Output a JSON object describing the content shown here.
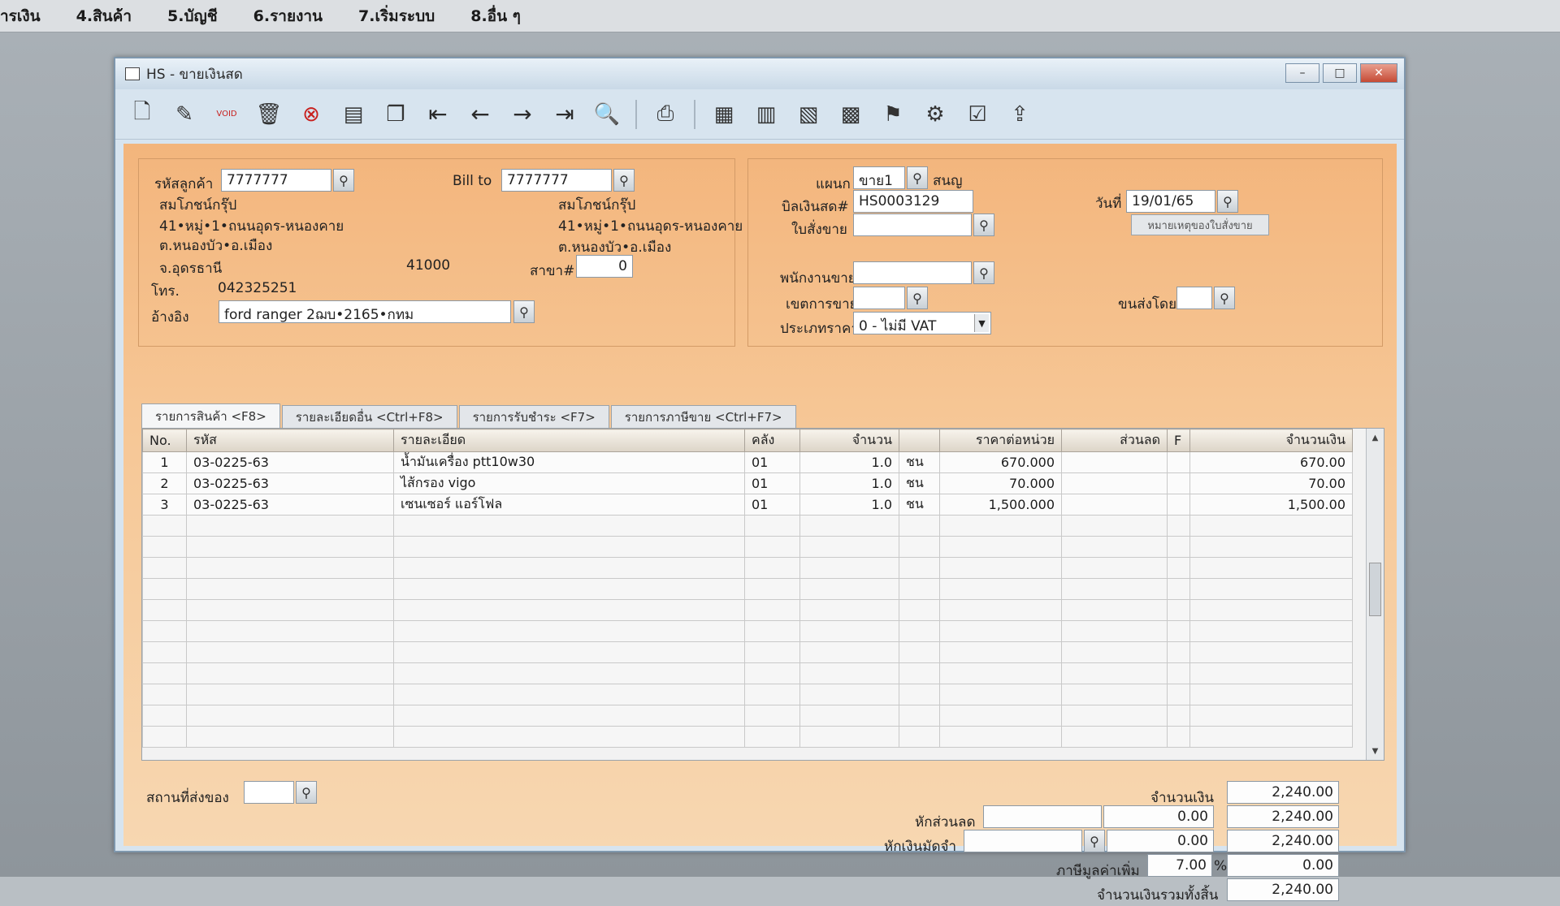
{
  "menubar": [
    "ารเงิน",
    "4.สินค้า",
    "5.บัญชี",
    "6.รายงาน",
    "7.เริ่มระบบ",
    "8.อื่น ๆ"
  ],
  "window": {
    "title": "HS - ขายเงินสด",
    "minimize": "–",
    "maximize": "□",
    "close": "✕"
  },
  "toolbar": [
    "new-doc",
    "edit",
    "void",
    "delete",
    "cancel",
    "save",
    "copy",
    "first",
    "prev",
    "next",
    "last",
    "find",
    "print",
    "report1",
    "report2",
    "report3",
    "calendar",
    "approve",
    "tools",
    "ok",
    "export"
  ],
  "customer": {
    "code_label": "รหัสลูกค้า",
    "code": "7777777",
    "name": "สมโภชน์กรุ๊ป",
    "addr1": "41•หมู่•1•ถนนอุดร-หนองคาย",
    "addr2": "ต.หนองบัว•อ.เมือง",
    "addr3": "จ.อุดรธานี",
    "zip": "41000",
    "tel_label": "โทร.",
    "tel": "042325251",
    "ref_label": "อ้างอิง",
    "ref": "ford ranger 2ฌบ•2165•กทม"
  },
  "billto": {
    "label": "Bill to",
    "code": "7777777",
    "name": "สมโภชน์กรุ๊ป",
    "addr1": "41•หมู่•1•ถนนอุดร-หนองคาย",
    "addr2": "ต.หนองบัว•อ.เมือง",
    "branch_label": "สาขา#",
    "branch": "0"
  },
  "right": {
    "dept_label": "แผนก",
    "dept": "ขาย1",
    "dept_name": "สนญ",
    "bill_label": "บิลเงินสด#",
    "bill": "HS0003129",
    "date_label": "วันที่",
    "date": "19/01/65",
    "order_label": "ใบสั่งขาย",
    "order": "",
    "note_btn": "หมายเหตุของใบสั่งขาย",
    "sales_label": "พนักงานขาย",
    "sales": "",
    "area_label": "เขตการขาย",
    "area": "",
    "ship_label": "ขนส่งโดย",
    "ship": "",
    "price_label": "ประเภทราคา",
    "price": "0 - ไม่มี VAT"
  },
  "tabs": [
    "รายการสินค้า <F8>",
    "รายละเอียดอื่น <Ctrl+F8>",
    "รายการรับชำระ <F7>",
    "รายการภาษีขาย <Ctrl+F7>"
  ],
  "columns": [
    "No.",
    "รหัส",
    "รายละเอียด",
    "คลัง",
    "จำนวน",
    "ราคาต่อหน่วย",
    "ส่วนลด",
    "F",
    "จำนวนเงิน"
  ],
  "rows": [
    {
      "no": "1",
      "code": "03-0225-63",
      "desc": "น้ำมันเครื่อง ptt10w30",
      "wh": "01",
      "qty": "1.0",
      "unit": "ชน",
      "price": "670.000",
      "disc": "",
      "f": "",
      "amount": "670.00"
    },
    {
      "no": "2",
      "code": "03-0225-63",
      "desc": "ไส้กรอง vigo",
      "wh": "01",
      "qty": "1.0",
      "unit": "ชน",
      "price": "70.000",
      "disc": "",
      "f": "",
      "amount": "70.00"
    },
    {
      "no": "3",
      "code": "03-0225-63",
      "desc": "เซนเซอร์ แอร์โฟล",
      "wh": "01",
      "qty": "1.0",
      "unit": "ชน",
      "price": "1,500.000",
      "disc": "",
      "f": "",
      "amount": "1,500.00"
    }
  ],
  "footer": {
    "shipto_label": "สถานที่ส่งของ",
    "shipto": "",
    "amount_label": "จำนวนเงิน",
    "amount": "2,240.00",
    "discount_label": "หักส่วนลด",
    "discount_input": "",
    "discount_value": "0.00",
    "after_discount": "2,240.00",
    "deposit_label": "หักเงินมัดจำ",
    "deposit_input": "",
    "deposit_value": "0.00",
    "after_deposit": "2,240.00",
    "vat_label": "ภาษีมูลค่าเพิ่ม",
    "vat_rate": "7.00",
    "vat_pct": "%",
    "vat_amount": "0.00",
    "total_label": "จำนวนเงินรวมทั้งสิ้น",
    "total": "2,240.00"
  }
}
